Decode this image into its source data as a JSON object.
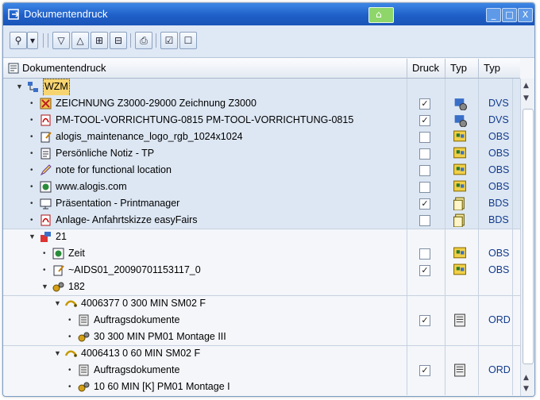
{
  "window": {
    "title": "Dokumentendruck"
  },
  "titlebar_buttons": [
    "_",
    "□",
    "X"
  ],
  "columns": {
    "tree": "Dokumentendruck",
    "druck": "Druck",
    "typ1": "Typ",
    "typ2": "Typ"
  },
  "rows": [
    {
      "label": "WZM",
      "indent": 0,
      "icon": "network-icon",
      "expander": "▼",
      "druck": null,
      "typ_icon": null,
      "typ_text": ""
    },
    {
      "label": "ZEICHNUNG Z3000-29000 Zeichnung Z3000",
      "indent": 1,
      "icon": "drawing-icon",
      "druck": true,
      "typ_icon": "dvs-icon",
      "typ_text": "DVS"
    },
    {
      "label": "PM-TOOL-VORRICHTUNG-0815 PM-TOOL-VORRICHTUNG-0815",
      "indent": 1,
      "icon": "pdf-icon",
      "druck": true,
      "typ_icon": "dvs-icon",
      "typ_text": "DVS"
    },
    {
      "label": "alogis_maintenance_logo_rgb_1024x1024",
      "indent": 1,
      "icon": "document-edit-icon",
      "druck": false,
      "typ_icon": "obs-icon",
      "typ_text": "OBS"
    },
    {
      "label": "Persönliche Notiz - TP",
      "indent": 1,
      "icon": "note-icon",
      "druck": false,
      "typ_icon": "obs-icon",
      "typ_text": "OBS"
    },
    {
      "label": "note for functional location",
      "indent": 1,
      "icon": "pencil-icon",
      "druck": false,
      "typ_icon": "obs-icon",
      "typ_text": "OBS"
    },
    {
      "label": "www.alogis.com",
      "indent": 1,
      "icon": "web-icon",
      "druck": false,
      "typ_icon": "obs-icon",
      "typ_text": "OBS"
    },
    {
      "label": "Präsentation - Printmanager",
      "indent": 1,
      "icon": "presentation-icon",
      "druck": true,
      "typ_icon": "bds-icon",
      "typ_text": "BDS"
    },
    {
      "label": "Anlage- Anfahrtskizze easyFairs",
      "indent": 1,
      "icon": "pdf-icon",
      "druck": false,
      "typ_icon": "bds-icon",
      "typ_text": "BDS"
    },
    {
      "label": "21",
      "indent": 1,
      "icon": "equipment-icon",
      "expander": "▼",
      "druck": null,
      "typ_icon": null,
      "typ_text": ""
    },
    {
      "label": "Zeit",
      "indent": 2,
      "icon": "web-icon",
      "druck": false,
      "typ_icon": "obs-icon",
      "typ_text": "OBS"
    },
    {
      "label": "~AIDS01_20090701153117_0",
      "indent": 2,
      "icon": "document-edit-icon",
      "druck": true,
      "typ_icon": "obs-icon",
      "typ_text": "OBS"
    },
    {
      "label": "182",
      "indent": 2,
      "icon": "gears-icon",
      "expander": "▼",
      "druck": null,
      "typ_icon": null,
      "typ_text": ""
    },
    {
      "label": "4006377   0    300 MIN SM02 F",
      "indent": 3,
      "icon": "order-icon",
      "expander": "▼",
      "druck": null,
      "typ_icon": null,
      "typ_text": ""
    },
    {
      "label": "Auftragsdokumente",
      "indent": 4,
      "icon": "form-icon",
      "druck": true,
      "typ_icon": "ord-icon",
      "typ_text": "ORD"
    },
    {
      "label": "30     300 MIN  PM01 Montage III",
      "indent": 4,
      "icon": "gears-icon",
      "druck": null,
      "typ_icon": null,
      "typ_text": ""
    },
    {
      "label": "4006413   0    60 MIN SM02 F",
      "indent": 3,
      "icon": "order-icon",
      "expander": "▼",
      "druck": null,
      "typ_icon": null,
      "typ_text": ""
    },
    {
      "label": "Auftragsdokumente",
      "indent": 4,
      "icon": "form-icon",
      "druck": true,
      "typ_icon": "ord-icon",
      "typ_text": "ORD"
    },
    {
      "label": "10      60 MIN [K] PM01 Montage I",
      "indent": 4,
      "icon": "gears-icon",
      "druck": null,
      "typ_icon": null,
      "typ_text": ""
    }
  ]
}
